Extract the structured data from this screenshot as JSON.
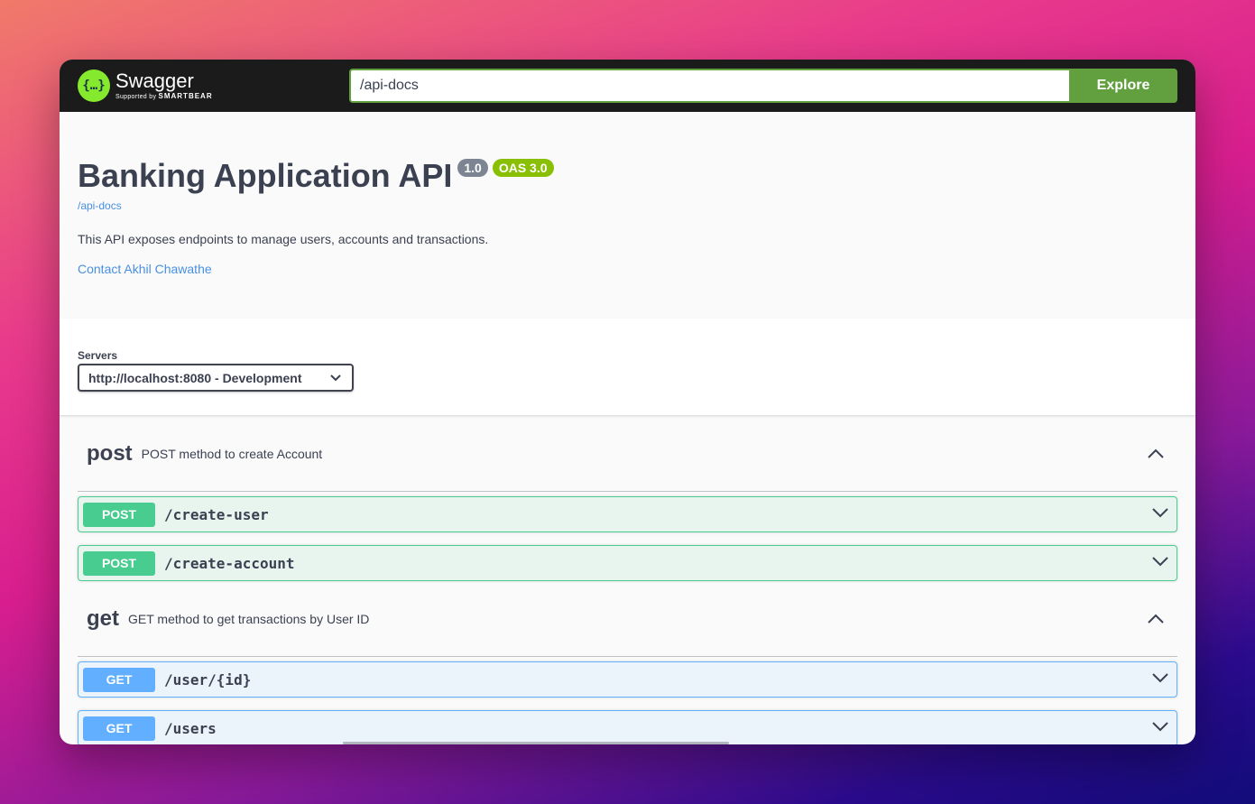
{
  "header": {
    "logo_word": "Swagger",
    "logo_sub_prefix": "Supported by",
    "logo_sub_brand": "SMARTBEAR",
    "search_value": "/api-docs",
    "explore_label": "Explore"
  },
  "info": {
    "title": "Banking Application API",
    "version": "1.0",
    "oas": "OAS 3.0",
    "url": "/api-docs",
    "description": "This API exposes endpoints to manage users, accounts and transactions.",
    "contact": "Contact Akhil Chawathe"
  },
  "servers": {
    "label": "Servers",
    "selected": "http://localhost:8080 - Development"
  },
  "tags": [
    {
      "name": "post",
      "description": "POST method to create Account",
      "operations": [
        {
          "method": "POST",
          "path": "/create-user"
        },
        {
          "method": "POST",
          "path": "/create-account"
        }
      ]
    },
    {
      "name": "get",
      "description": "GET method to get transactions by User ID",
      "operations": [
        {
          "method": "GET",
          "path": "/user/{id}"
        },
        {
          "method": "GET",
          "path": "/users"
        }
      ]
    }
  ],
  "colors": {
    "post": "#49cc90",
    "get": "#61affe",
    "explore": "#62a03f",
    "oas_badge": "#89bf04"
  }
}
